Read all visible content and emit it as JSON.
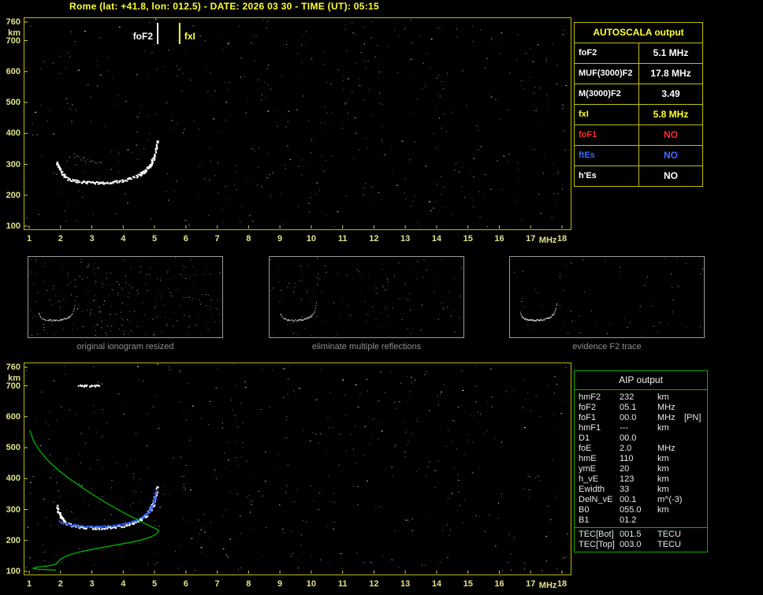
{
  "header": {
    "title": "Rome (lat: +41.8, lon: 012.5) - DATE: 2026 03 30 - TIME (UT): 05:15"
  },
  "colors": {
    "background": "#000000",
    "title": "#ffff33",
    "plot_border": "#b8b800",
    "axis_labels": "#e2e28a",
    "aip_border": "#00b400",
    "trace_white": "#ffffff",
    "trace_blue": "#2f5fff",
    "profile_green": "#00c000"
  },
  "autoscala": {
    "title": "AUTOSCALA output",
    "rows": [
      {
        "label": "foF2",
        "value": "5.1 MHz",
        "color": "#ffffff"
      },
      {
        "label": "MUF(3000)F2",
        "value": "17.8 MHz",
        "color": "#ffffff"
      },
      {
        "label": "M(3000)F2",
        "value": "3.49",
        "color": "#ffffff"
      },
      {
        "label": "fxI",
        "value": "5.8 MHz",
        "color": "#ffff33"
      },
      {
        "label": "foF1",
        "value": "NO",
        "color": "#ff2a2a"
      },
      {
        "label": "ftEs",
        "value": "NO",
        "color": "#3b6bff"
      },
      {
        "label": "h'Es",
        "value": "NO",
        "color": "#ffffff"
      }
    ]
  },
  "aip": {
    "title": "AIP output",
    "rows": [
      {
        "label": "hmF2",
        "value": "232",
        "unit": "km",
        "extra": ""
      },
      {
        "label": "foF2",
        "value": "05.1",
        "unit": "MHz",
        "extra": ""
      },
      {
        "label": "foF1",
        "value": "00.0",
        "unit": "MHz",
        "extra": "[PN]"
      },
      {
        "label": "hmF1",
        "value": "---",
        "unit": "km",
        "extra": ""
      },
      {
        "label": "D1",
        "value": "00.0",
        "unit": "",
        "extra": ""
      },
      {
        "label": "foE",
        "value": "2.0",
        "unit": "MHz",
        "extra": ""
      },
      {
        "label": "hmE",
        "value": "110",
        "unit": "km",
        "extra": ""
      },
      {
        "label": "ymE",
        "value": "20",
        "unit": "km",
        "extra": ""
      },
      {
        "label": "h_vE",
        "value": "123",
        "unit": "km",
        "extra": ""
      },
      {
        "label": "Ewidth",
        "value": "33",
        "unit": "km",
        "extra": ""
      },
      {
        "label": "DelN_vE",
        "value": "00.1",
        "unit": "m^(-3)",
        "extra": ""
      },
      {
        "label": "B0",
        "value": "055.0",
        "unit": "km",
        "extra": ""
      },
      {
        "label": "B1",
        "value": "01.2",
        "unit": "",
        "extra": ""
      }
    ],
    "tec_rows": [
      {
        "label": "TEC[Bot]",
        "value": "001.5",
        "unit": "TECU"
      },
      {
        "label": "TEC[Top]",
        "value": "003.0",
        "unit": "TECU"
      }
    ]
  },
  "thumbnails": {
    "items": [
      {
        "caption": "original ionogram resized"
      },
      {
        "caption": "eliminate multiple reflections"
      },
      {
        "caption": "evidence F2 trace"
      }
    ]
  },
  "chart_data": {
    "type": "scatter",
    "x_label": "MHz",
    "y_label": "km",
    "x_range": [
      1,
      18
    ],
    "y_range": [
      100,
      760
    ],
    "x_ticks": [
      1,
      2,
      3,
      4,
      5,
      6,
      7,
      8,
      9,
      10,
      11,
      12,
      13,
      14,
      15,
      16,
      17,
      18
    ],
    "y_ticks": [
      760,
      700,
      600,
      500,
      400,
      300,
      200,
      100
    ],
    "plots": [
      {
        "name": "recorded ionogram",
        "markers": [
          {
            "label": "foF2",
            "f_mhz": 5.1,
            "color": "#ffffff"
          },
          {
            "label": "fxI",
            "f_mhz": 5.8,
            "color": "#ffff33"
          }
        ],
        "f2_trace": [
          [
            1.88,
            308
          ],
          [
            1.95,
            288
          ],
          [
            2.05,
            270
          ],
          [
            2.2,
            256
          ],
          [
            2.45,
            248
          ],
          [
            2.75,
            244
          ],
          [
            3.05,
            242
          ],
          [
            3.35,
            242
          ],
          [
            3.65,
            244
          ],
          [
            3.95,
            249
          ],
          [
            4.25,
            257
          ],
          [
            4.5,
            267
          ],
          [
            4.7,
            281
          ],
          [
            4.85,
            299
          ],
          [
            4.95,
            322
          ],
          [
            5.02,
            350
          ],
          [
            5.07,
            374
          ],
          [
            5.1,
            398
          ]
        ],
        "faint_arc": [
          [
            2.4,
            332
          ],
          [
            2.7,
            318
          ],
          [
            3.0,
            309
          ],
          [
            3.3,
            304
          ]
        ]
      },
      {
        "name": "scaled ionogram with restored trace and electron density profile",
        "f2_trace": [
          [
            1.88,
            308
          ],
          [
            1.95,
            288
          ],
          [
            2.05,
            270
          ],
          [
            2.2,
            256
          ],
          [
            2.45,
            248
          ],
          [
            2.75,
            244
          ],
          [
            3.05,
            242
          ],
          [
            3.35,
            242
          ],
          [
            3.65,
            244
          ],
          [
            3.95,
            249
          ],
          [
            4.25,
            257
          ],
          [
            4.5,
            267
          ],
          [
            4.7,
            281
          ],
          [
            4.85,
            299
          ],
          [
            4.95,
            322
          ],
          [
            5.02,
            350
          ],
          [
            5.07,
            374
          ],
          [
            5.1,
            398
          ]
        ],
        "restored_trace": [
          [
            1.95,
            262
          ],
          [
            2.2,
            254
          ],
          [
            2.5,
            249
          ],
          [
            2.9,
            246
          ],
          [
            3.3,
            246
          ],
          [
            3.7,
            250
          ],
          [
            4.0,
            256
          ],
          [
            4.3,
            264
          ],
          [
            4.6,
            277
          ],
          [
            4.8,
            294
          ],
          [
            4.92,
            315
          ],
          [
            5.0,
            340
          ],
          [
            5.06,
            368
          ]
        ],
        "density_profile": [
          [
            1.02,
            556
          ],
          [
            1.15,
            520
          ],
          [
            1.35,
            488
          ],
          [
            1.6,
            458
          ],
          [
            1.9,
            430
          ],
          [
            2.25,
            402
          ],
          [
            2.65,
            374
          ],
          [
            3.05,
            347
          ],
          [
            3.45,
            322
          ],
          [
            3.85,
            299
          ],
          [
            4.2,
            280
          ],
          [
            4.5,
            265
          ],
          [
            4.75,
            252
          ],
          [
            4.95,
            242
          ],
          [
            5.08,
            236
          ],
          [
            5.13,
            232
          ],
          [
            5.08,
            222
          ],
          [
            4.9,
            212
          ],
          [
            4.6,
            202
          ],
          [
            4.2,
            193
          ],
          [
            3.7,
            184
          ],
          [
            3.2,
            175
          ],
          [
            2.75,
            166
          ],
          [
            2.4,
            157
          ],
          [
            2.15,
            148
          ],
          [
            2.0,
            139
          ],
          [
            1.92,
            130
          ],
          [
            1.86,
            124
          ],
          [
            1.7,
            119
          ],
          [
            1.45,
            116
          ],
          [
            1.22,
            113
          ],
          [
            1.12,
            110
          ],
          [
            1.3,
            107
          ],
          [
            1.6,
            105
          ],
          [
            1.85,
            104
          ]
        ],
        "artifact_streak": {
          "f_mhz_start": 2.55,
          "f_mhz_end": 3.22,
          "km": 702
        }
      }
    ]
  }
}
